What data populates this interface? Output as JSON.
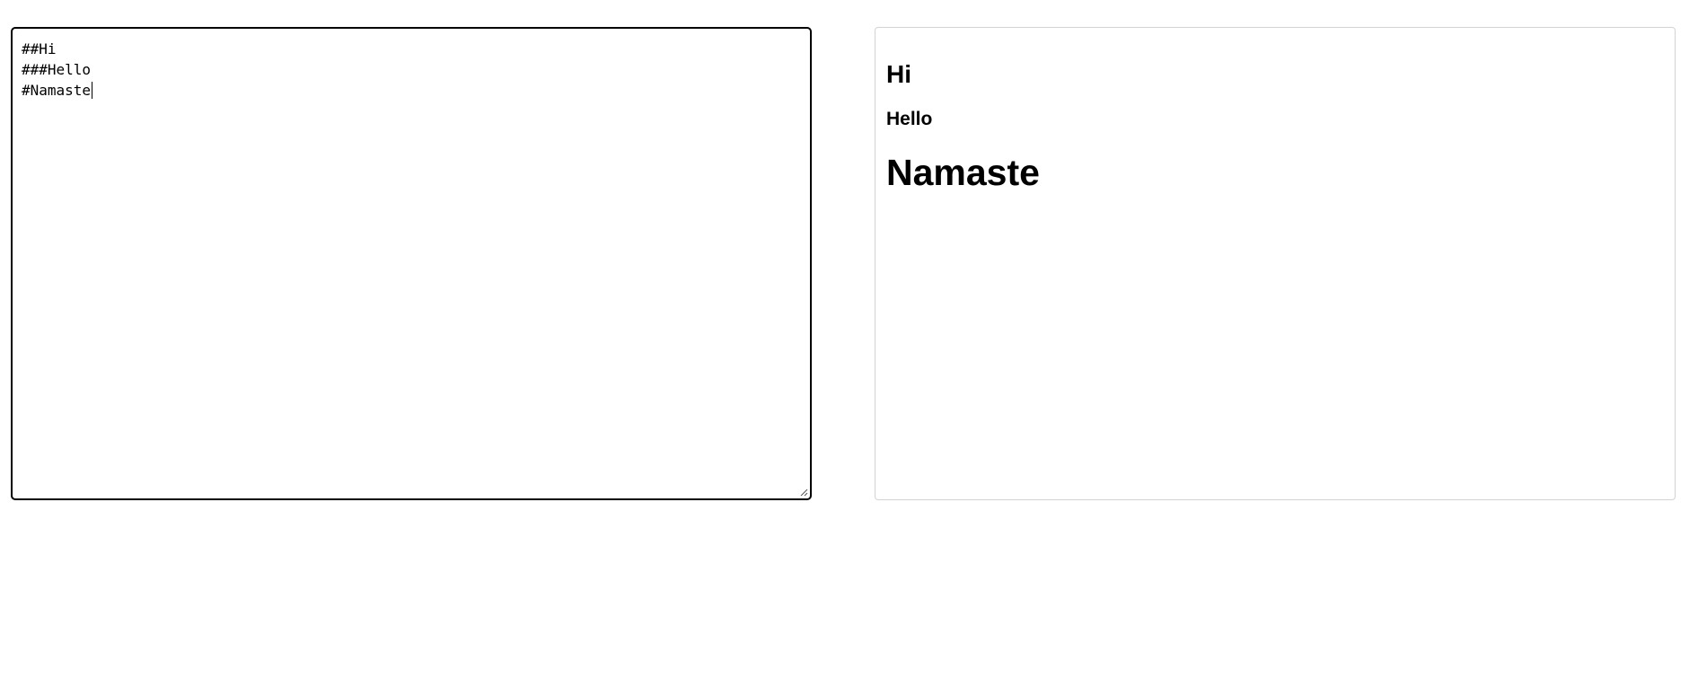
{
  "editor": {
    "lines": [
      "##Hi",
      "###Hello",
      "#Namaste"
    ]
  },
  "preview": {
    "headings": [
      {
        "level": 2,
        "text": "Hi"
      },
      {
        "level": 3,
        "text": "Hello"
      },
      {
        "level": 1,
        "text": "Namaste"
      }
    ]
  },
  "colors": {
    "editor_border": "#000000",
    "preview_border": "#d3d3d3",
    "text": "#000000",
    "background": "#ffffff"
  }
}
